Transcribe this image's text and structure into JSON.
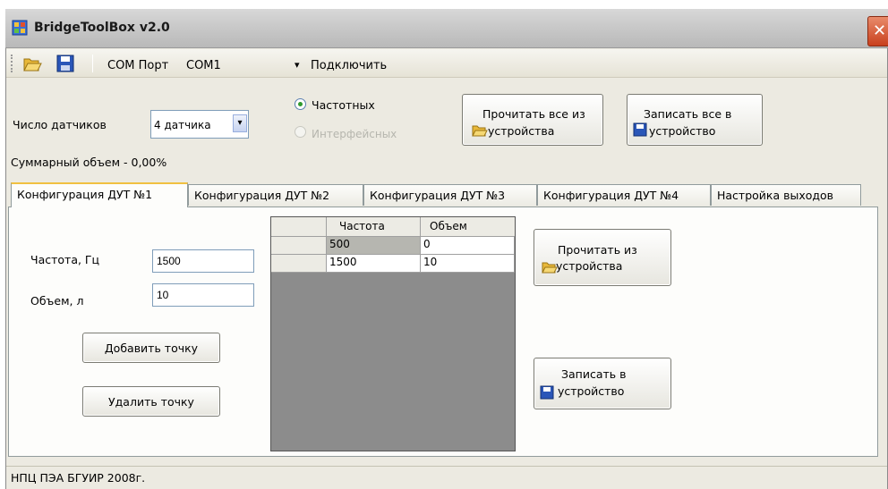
{
  "window": {
    "title": "BridgeToolBox v2.0",
    "close_glyph": "✕"
  },
  "toolbar": {
    "open_icon": "folder-open-icon",
    "save_icon": "floppy-save-icon",
    "port_label": "COM Порт",
    "port_value": "COM1",
    "dropdown_glyph": "▾",
    "connect_label": "Подключить"
  },
  "top_panel": {
    "sensor_count_label": "Число датчиков",
    "sensor_count_value": "4 датчика",
    "radio_frequency_label": "Частотных",
    "radio_interface_label": "Интерфейсных",
    "read_all_line1": "Прочитать все из",
    "read_all_line2": "устройства",
    "write_all_line1": "Записать все в",
    "write_all_line2": "устройство",
    "total_volume": "Суммарный объем - 0,00%"
  },
  "tabs": [
    {
      "label": "Конфигурация ДУТ №1"
    },
    {
      "label": "Конфигурация ДУТ №2"
    },
    {
      "label": "Конфигурация ДУТ №3"
    },
    {
      "label": "Конфигурация ДУТ №4"
    },
    {
      "label": "Настройка выходов"
    }
  ],
  "config": {
    "freq_label": "Частота, Гц",
    "freq_value": "1500",
    "volume_label": "Объем, л",
    "volume_value": "10",
    "add_point": "Добавить точку",
    "delete_point": "Удалить точку",
    "read_line1": "Прочитать из",
    "read_line2": "устройства",
    "write_line1": "Записать в",
    "write_line2": "устройство"
  },
  "grid": {
    "headers": [
      "Частота",
      "Объем"
    ],
    "rows": [
      [
        "500",
        "0"
      ],
      [
        "1500",
        "10"
      ]
    ]
  },
  "status": {
    "text": "НПЦ ПЭА БГУИР 2008г."
  },
  "colors": {
    "accent_tab": "#f0c040",
    "grid_bg": "#8c8c8c",
    "close": "#c9401d"
  }
}
